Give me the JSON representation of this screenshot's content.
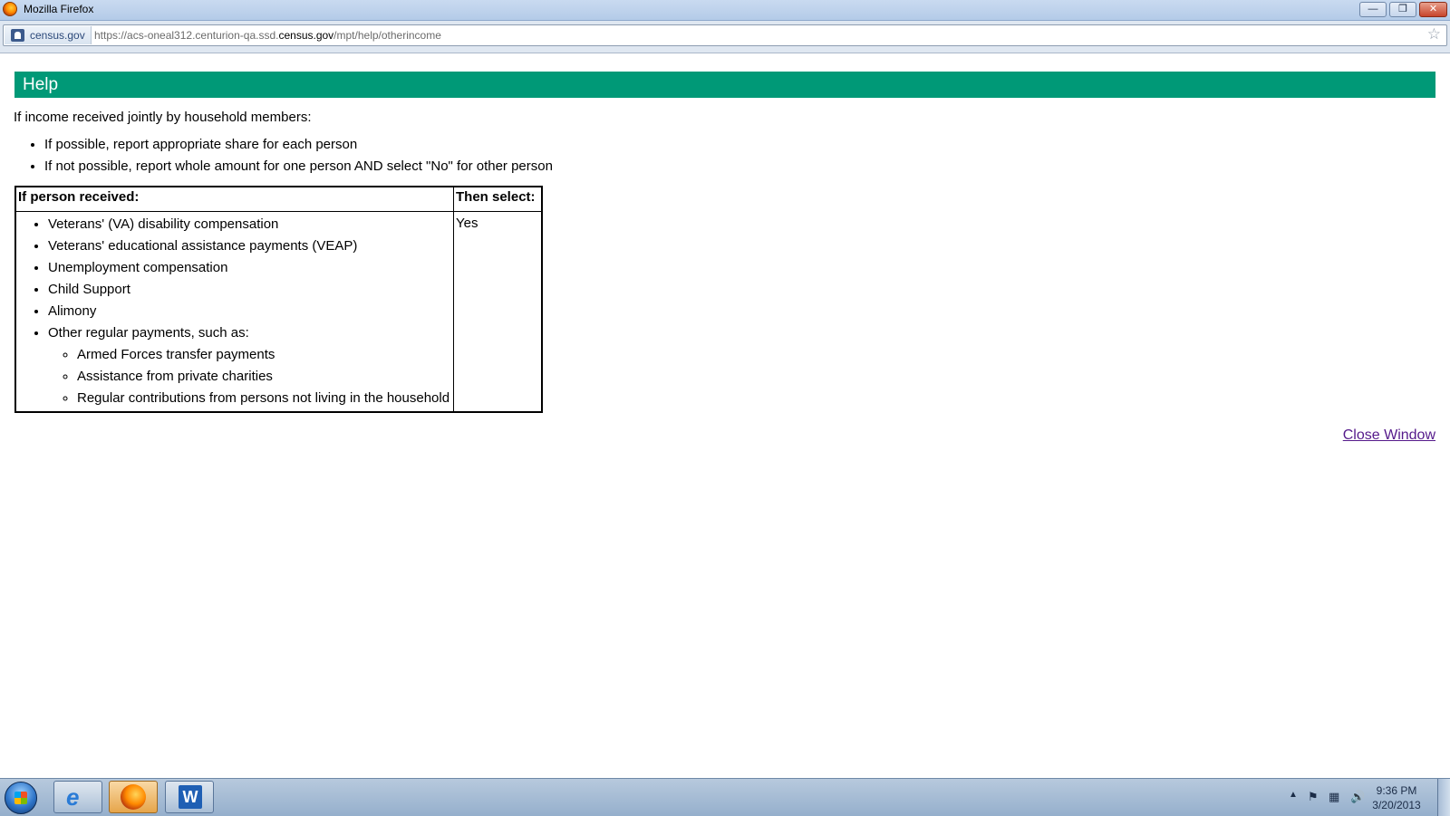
{
  "window": {
    "title": "Mozilla Firefox",
    "controls": {
      "minimize": "—",
      "maximize": "❐",
      "close": "✕"
    }
  },
  "addressbar": {
    "site_label": "census.gov",
    "url_prefix": "https://acs-oneal312.centurion-qa.ssd.",
    "url_domain": "census.gov",
    "url_path": "/mpt/help/otherincome",
    "bookmark_star": "☆"
  },
  "page": {
    "header": "Help",
    "intro": "If income received jointly by household members:",
    "intro_items": [
      "If possible, report appropriate share for each person",
      "If not possible, report whole amount for one person AND select \"No\" for other person"
    ],
    "table": {
      "col1_header": "If person received:",
      "col2_header": "Then select:",
      "items": [
        "Veterans' (VA) disability compensation",
        "Veterans' educational assistance payments (VEAP)",
        "Unemployment compensation",
        "Child Support",
        "Alimony",
        "Other regular payments, such as:"
      ],
      "sub_items": [
        "Armed Forces transfer payments",
        "Assistance from private charities",
        "Regular contributions from persons not living in the household"
      ],
      "select_value": "Yes"
    },
    "close_link": "Close Window"
  },
  "taskbar": {
    "time": "9:36 PM",
    "date": "3/20/2013",
    "word_glyph": "W",
    "ie_glyph": "e",
    "tray_up": "▲",
    "tray_flag": "⚑",
    "tray_net": "▦",
    "tray_volume": "🔊"
  },
  "icons": {
    "window": "firefox-icon",
    "address": "site-identity-icon",
    "bookmark": "star-icon",
    "start": "windows-start-icon"
  }
}
